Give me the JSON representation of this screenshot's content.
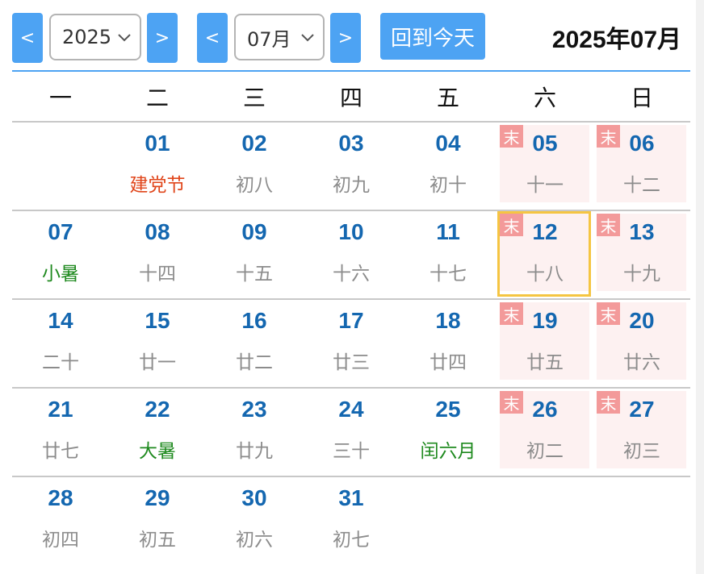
{
  "toolbar": {
    "prev_year_label": "<",
    "year_value": "2025",
    "next_year_label": ">",
    "prev_month_label": "<",
    "month_value": "07月",
    "next_month_label": ">",
    "today_label": "回到今天",
    "title": "2025年07月"
  },
  "weekdays": [
    "一",
    "二",
    "三",
    "四",
    "五",
    "六",
    "日"
  ],
  "weekend_badge": "末",
  "colors": {
    "accent": "#4da3f3",
    "day_number": "#1467b0",
    "weekend_bg": "#fdf1f1",
    "badge": "#f39a9a",
    "today_border": "#f5c542",
    "holiday_red": "#e0451a",
    "solar_term_green": "#1f8a1f"
  },
  "weeks": [
    [
      null,
      {
        "day": "01",
        "lunar": "建党节",
        "style": "red"
      },
      {
        "day": "02",
        "lunar": "初八"
      },
      {
        "day": "03",
        "lunar": "初九"
      },
      {
        "day": "04",
        "lunar": "初十"
      },
      {
        "day": "05",
        "lunar": "十一",
        "weekend": true
      },
      {
        "day": "06",
        "lunar": "十二",
        "weekend": true
      }
    ],
    [
      {
        "day": "07",
        "lunar": "小暑",
        "style": "green"
      },
      {
        "day": "08",
        "lunar": "十四"
      },
      {
        "day": "09",
        "lunar": "十五"
      },
      {
        "day": "10",
        "lunar": "十六"
      },
      {
        "day": "11",
        "lunar": "十七"
      },
      {
        "day": "12",
        "lunar": "十八",
        "weekend": true,
        "today": true
      },
      {
        "day": "13",
        "lunar": "十九",
        "weekend": true
      }
    ],
    [
      {
        "day": "14",
        "lunar": "二十"
      },
      {
        "day": "15",
        "lunar": "廿一"
      },
      {
        "day": "16",
        "lunar": "廿二"
      },
      {
        "day": "17",
        "lunar": "廿三"
      },
      {
        "day": "18",
        "lunar": "廿四"
      },
      {
        "day": "19",
        "lunar": "廿五",
        "weekend": true
      },
      {
        "day": "20",
        "lunar": "廿六",
        "weekend": true
      }
    ],
    [
      {
        "day": "21",
        "lunar": "廿七"
      },
      {
        "day": "22",
        "lunar": "大暑",
        "style": "green"
      },
      {
        "day": "23",
        "lunar": "廿九"
      },
      {
        "day": "24",
        "lunar": "三十"
      },
      {
        "day": "25",
        "lunar": "闰六月",
        "style": "green"
      },
      {
        "day": "26",
        "lunar": "初二",
        "weekend": true
      },
      {
        "day": "27",
        "lunar": "初三",
        "weekend": true
      }
    ],
    [
      {
        "day": "28",
        "lunar": "初四"
      },
      {
        "day": "29",
        "lunar": "初五"
      },
      {
        "day": "30",
        "lunar": "初六"
      },
      {
        "day": "31",
        "lunar": "初七"
      },
      null,
      null,
      null
    ]
  ]
}
